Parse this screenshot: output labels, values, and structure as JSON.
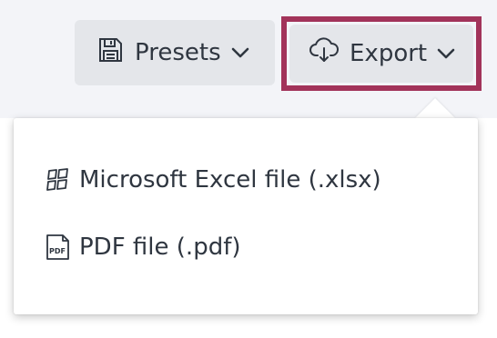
{
  "toolbar": {
    "presets_label": "Presets",
    "export_label": "Export"
  },
  "export_menu": {
    "items": [
      {
        "label": "Microsoft Excel file (.xlsx)",
        "icon": "excel-file-icon"
      },
      {
        "label": "PDF file (.pdf)",
        "icon": "pdf-file-icon"
      }
    ],
    "pdf_icon_text": "PDF"
  },
  "colors": {
    "highlight": "#a2335a",
    "button_bg": "#e4e6ea",
    "text": "#2f3640",
    "toolbar_bg": "#f3f4f8"
  }
}
